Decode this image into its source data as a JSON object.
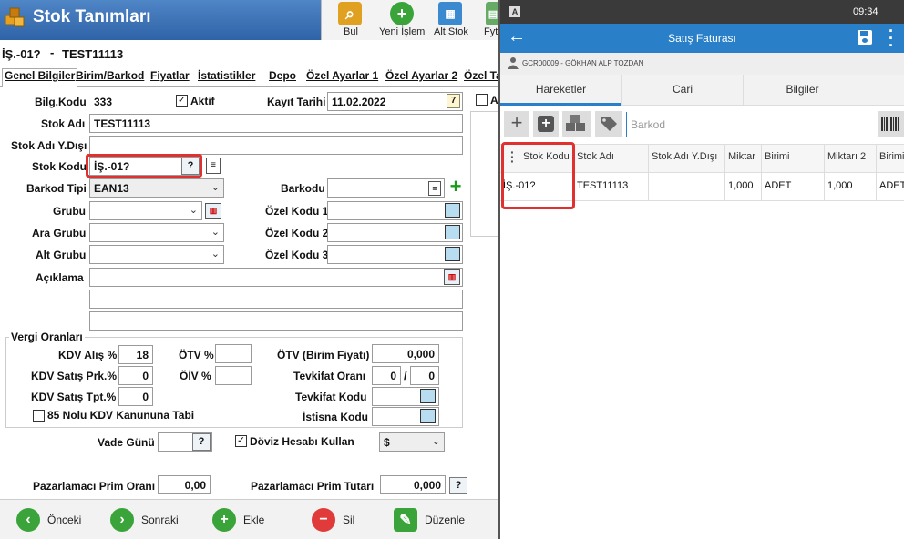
{
  "win": {
    "title": "Stok Tanımları"
  },
  "toolbar": {
    "bul": "Bul",
    "yeni": "Yeni İşlem",
    "alt": "Alt Stok",
    "fy": "Fyt"
  },
  "header": {
    "code": "İŞ.-01?",
    "sep": "-",
    "name": "TEST11113"
  },
  "tabs": [
    "Genel Bilgiler",
    "Birim/Barkod",
    "Fiyatlar",
    "İstatistikler",
    "Depo",
    "Özel Ayarlar 1",
    "Özel Ayarlar 2",
    "Özel Ta"
  ],
  "form": {
    "bilgkodu_lbl": "Bilg.Kodu",
    "bilgkodu": "333",
    "aktif": "Aktif",
    "aktif_mark": "✓",
    "kayit_lbl": "Kayıt Tarihi",
    "kayit": "11.02.2022",
    "cal_day": "7",
    "stokadi_lbl": "Stok Adı",
    "stokadi": "TEST11113",
    "ydisi_lbl": "Stok Adı Y.Dışı",
    "ydisi": "",
    "stokkodu_lbl": "Stok Kodu",
    "stokkodu": "İŞ.-01?",
    "q": "?",
    "barkodtipi_lbl": "Barkod Tipi",
    "barkodtipi": "EAN13",
    "barkodu_lbl": "Barkodu",
    "grubu_lbl": "Grubu",
    "aragrubu_lbl": "Ara Grubu",
    "altgrubu_lbl": "Alt Grubu",
    "oz1_lbl": "Özel Kodu 1",
    "oz2_lbl": "Özel Kodu 2",
    "oz3_lbl": "Özel Kodu 3",
    "aciklama_lbl": "Açıklama",
    "right_a": "A"
  },
  "vergi": {
    "title": "Vergi Oranları",
    "kdv_alis_lbl": "KDV Alış %",
    "kdv_alis": "18",
    "kdv_prk_lbl": "KDV Satış Prk.%",
    "kdv_prk": "0",
    "kdv_tpt_lbl": "KDV Satış Tpt.%",
    "kdv_tpt": "0",
    "otv_lbl": "ÖTV %",
    "oiv_lbl": "ÖİV %",
    "otv_birim_lbl": "ÖTV (Birim Fiyatı)",
    "otv_birim": "0,000",
    "tevk_oran_lbl": "Tevkifat Oranı",
    "tevk1": "0",
    "slash": "/",
    "tevk2": "0",
    "tevk_kod_lbl": "Tevkifat Kodu",
    "istisna_lbl": "İstisna Kodu",
    "kanun": "85 Nolu KDV Kanununa Tabi"
  },
  "bottom": {
    "vade_lbl": "Vade Günü",
    "doviz": "Döviz Hesabı Kullan",
    "doviz_mark": "✓",
    "currency": "$",
    "prim_oran_lbl": "Pazarlamacı Prim Oranı",
    "prim_oran": "0,00",
    "prim_tutar_lbl": "Pazarlamacı Prim Tutarı",
    "prim_tutar": "0,000"
  },
  "footer": {
    "onceki": "Önceki",
    "sonraki": "Sonraki",
    "ekle": "Ekle",
    "sil": "Sil",
    "duzenle": "Düzenle"
  },
  "mobile": {
    "status_a": "A",
    "time": "09:34",
    "title": "Satış Faturası",
    "customer": "GCR00009 - GÖKHAN ALP TOZDAN",
    "tabs": [
      "Hareketler",
      "Cari",
      "Bilgiler"
    ],
    "search_placeholder": "Barkod",
    "cols": [
      "Stok Kodu",
      "Stok Adı",
      "Stok Adı Y.Dışı",
      "Miktar",
      "Birimi",
      "Miktarı 2",
      "Birimi"
    ],
    "row": [
      "İŞ.-01?",
      "TEST11113",
      "",
      "1,000",
      "ADET",
      "1,000",
      "ADET"
    ]
  }
}
